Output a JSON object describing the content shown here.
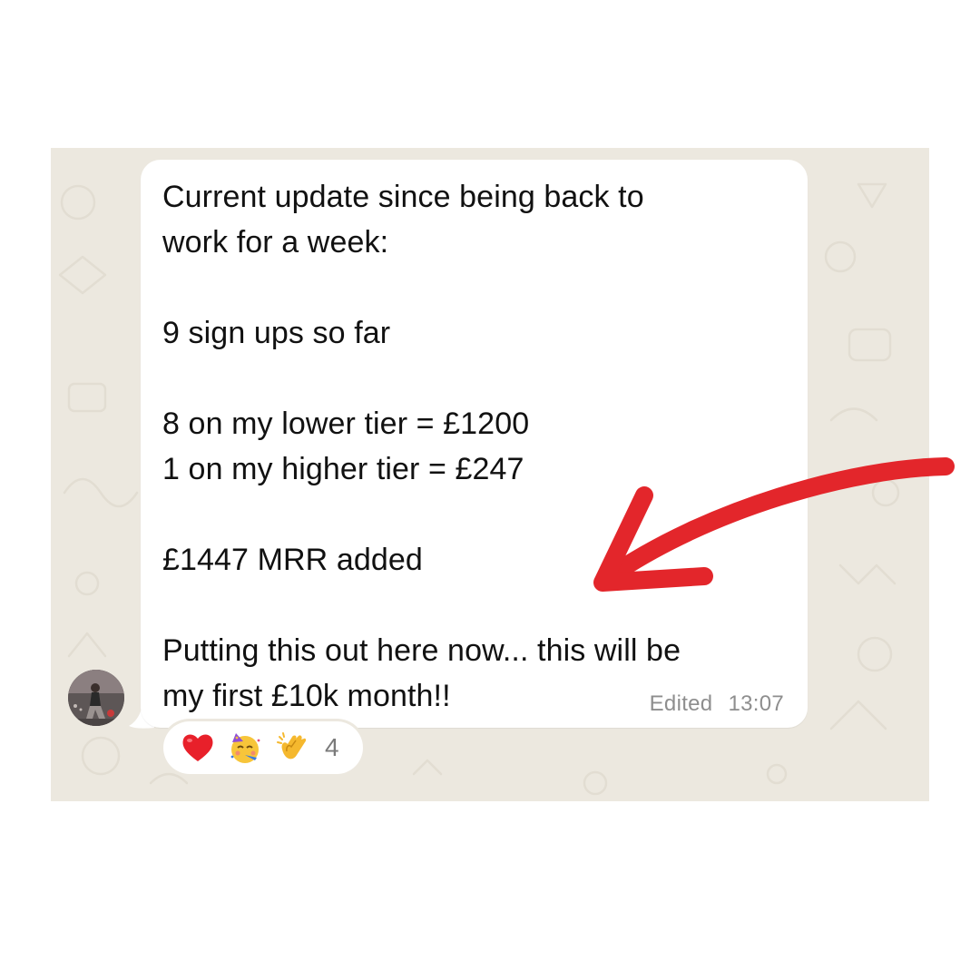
{
  "message": {
    "lines": [
      "Current update since being back to",
      "work for a week:",
      "",
      "9 sign ups so far",
      "",
      "8 on my lower tier = £1200",
      "1 on my higher tier = £247",
      "",
      "£1447 MRR added",
      "",
      "Putting this out here now... this will be",
      "my first £10k month!!"
    ],
    "edited_label": "Edited",
    "time": "13:07"
  },
  "reactions": {
    "icons": [
      "red-heart-emoji",
      "partying-face-emoji",
      "clapping-hands-emoji"
    ],
    "count": "4"
  },
  "colors": {
    "chat_background": "#ece8df",
    "bubble": "#ffffff",
    "arrow": "#e3262b",
    "meta_text": "#8e8e8e"
  }
}
